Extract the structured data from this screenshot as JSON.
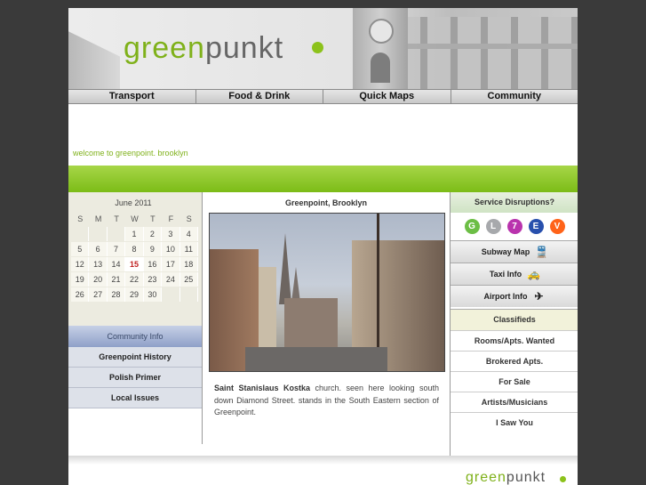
{
  "header": {
    "logo_part1": "green",
    "logo_part2": "punkt"
  },
  "nav": [
    "Transport",
    "Food & Drink",
    "Quick Maps",
    "Community"
  ],
  "welcome": "welcome to greenpoint. brooklyn",
  "calendar": {
    "title": "June 2011",
    "dow": [
      "S",
      "M",
      "T",
      "W",
      "T",
      "F",
      "S"
    ],
    "weeks": [
      [
        "",
        "",
        "",
        "1",
        "2",
        "3",
        "4"
      ],
      [
        "5",
        "6",
        "7",
        "8",
        "9",
        "10",
        "11"
      ],
      [
        "12",
        "13",
        "14",
        "15",
        "16",
        "17",
        "18"
      ],
      [
        "19",
        "20",
        "21",
        "22",
        "23",
        "24",
        "25"
      ],
      [
        "26",
        "27",
        "28",
        "29",
        "30",
        "",
        ""
      ]
    ],
    "today": "15"
  },
  "community": {
    "header": "Community Info",
    "items": [
      "Greenpoint History",
      "Polish Primer",
      "Local Issues"
    ]
  },
  "center": {
    "title": "Greenpoint, Brooklyn",
    "caption_bold": "Saint Stanislaus Kostka",
    "caption_rest": " church. seen here looking south down Diamond Street. stands in the South Eastern section of Greenpoint."
  },
  "service": {
    "header": "Service Disruptions?",
    "lines": [
      {
        "label": "G",
        "color": "#6cbe45"
      },
      {
        "label": "L",
        "color": "#a7a9ac"
      },
      {
        "label": "7",
        "color": "#b933ad"
      },
      {
        "label": "E",
        "color": "#2850ad"
      },
      {
        "label": "V",
        "color": "#ff6319"
      }
    ],
    "buttons": [
      {
        "label": "Subway Map",
        "icon": "train-icon"
      },
      {
        "label": "Taxi Info",
        "icon": "taxi-icon"
      },
      {
        "label": "Airport Info",
        "icon": "airplane-icon"
      }
    ]
  },
  "classifieds": {
    "header": "Classifieds",
    "items": [
      "Rooms/Apts. Wanted",
      "Brokered Apts.",
      "For Sale",
      "Artists/Musicians",
      "I Saw You"
    ]
  },
  "footer": {
    "logo_part1": "green",
    "logo_part2": "punkt"
  }
}
